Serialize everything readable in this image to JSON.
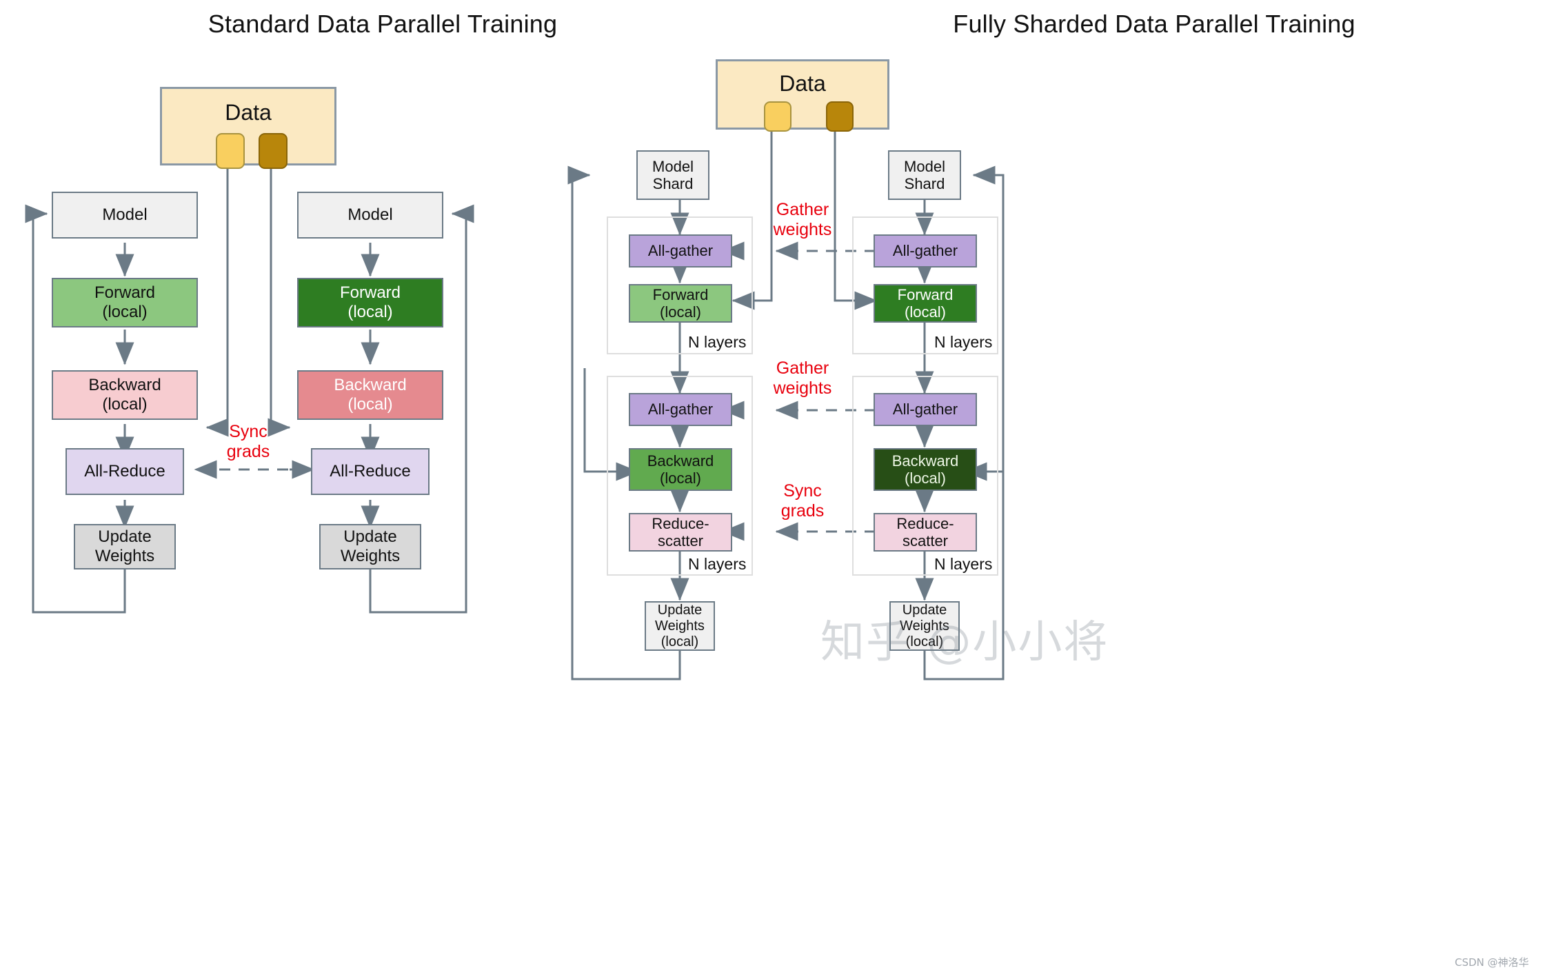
{
  "left": {
    "title": "Standard Data Parallel Training",
    "data_box": {
      "label": "Data",
      "chips": [
        "shard-light",
        "shard-dark"
      ]
    },
    "workers": [
      {
        "id": "worker-0",
        "shade": "light",
        "nodes": [
          {
            "name": "model",
            "line1": "Model",
            "line2": ""
          },
          {
            "name": "forward",
            "line1": "Forward",
            "line2": "(local)"
          },
          {
            "name": "backward",
            "line1": "Backward",
            "line2": "(local)"
          },
          {
            "name": "all-reduce",
            "line1": "All-Reduce",
            "line2": ""
          },
          {
            "name": "update-weights",
            "line1": "Update",
            "line2": "Weights"
          }
        ]
      },
      {
        "id": "worker-1",
        "shade": "dark",
        "nodes": [
          {
            "name": "model",
            "line1": "Model",
            "line2": ""
          },
          {
            "name": "forward",
            "line1": "Forward",
            "line2": "(local)"
          },
          {
            "name": "backward",
            "line1": "Backward",
            "line2": "(local)"
          },
          {
            "name": "all-reduce",
            "line1": "All-Reduce",
            "line2": ""
          },
          {
            "name": "update-weights",
            "line1": "Update",
            "line2": "Weights"
          }
        ]
      }
    ],
    "annotations": [
      {
        "name": "sync-grads",
        "line1": "Sync",
        "line2": "grads"
      }
    ]
  },
  "right": {
    "title": "Fully Sharded Data Parallel Training",
    "data_box": {
      "label": "Data",
      "chips": [
        "shard-light",
        "shard-dark"
      ]
    },
    "workers": [
      {
        "id": "worker-0",
        "shade": "light",
        "model_shard": {
          "line1": "Model",
          "line2": "Shard"
        },
        "block1": [
          {
            "name": "all-gather",
            "line1": "All-gather",
            "line2": ""
          },
          {
            "name": "forward",
            "line1": "Forward",
            "line2": "(local)"
          }
        ],
        "block1_label": "N layers",
        "block2": [
          {
            "name": "all-gather",
            "line1": "All-gather",
            "line2": ""
          },
          {
            "name": "backward",
            "line1": "Backward",
            "line2": "(local)"
          },
          {
            "name": "reduce-scatter",
            "line1": "Reduce-",
            "line2": "scatter"
          }
        ],
        "block2_label": "N layers",
        "update": {
          "line1": "Update",
          "line2": "Weights",
          "line3": "(local)"
        }
      },
      {
        "id": "worker-1",
        "shade": "dark",
        "model_shard": {
          "line1": "Model",
          "line2": "Shard"
        },
        "block1": [
          {
            "name": "all-gather",
            "line1": "All-gather",
            "line2": ""
          },
          {
            "name": "forward",
            "line1": "Forward",
            "line2": "(local)"
          }
        ],
        "block1_label": "N layers",
        "block2": [
          {
            "name": "all-gather",
            "line1": "All-gather",
            "line2": ""
          },
          {
            "name": "backward",
            "line1": "Backward",
            "line2": "(local)"
          },
          {
            "name": "reduce-scatter",
            "line1": "Reduce-",
            "line2": "scatter"
          }
        ],
        "block2_label": "N layers",
        "update": {
          "line1": "Update",
          "line2": "Weights",
          "line3": "(local)"
        }
      }
    ],
    "annotations": [
      {
        "name": "gather-weights-1",
        "line1": "Gather",
        "line2": "weights"
      },
      {
        "name": "gather-weights-2",
        "line1": "Gather",
        "line2": "weights"
      },
      {
        "name": "sync-grads",
        "line1": "Sync",
        "line2": "grads"
      }
    ]
  },
  "watermark": {
    "zhihu": "知乎 @小小将",
    "csdn": "CSDN @神洛华"
  },
  "colors": {
    "stroke": "#6b7a86",
    "red_label": "#e8000d",
    "data_fill": "#fbe9c2",
    "chip_light": "#f9cf5f",
    "chip_dark": "#b8860b",
    "grey": "#f0f0f0",
    "grey_dark": "#d9d9d9",
    "green_light": "#8cc77f",
    "green_mid": "#61aa4f",
    "green_dark": "#2e7d22",
    "green_darkest": "#274e16",
    "red_light": "#f7ccd0",
    "red_mid": "#e58a8f",
    "purple_light": "#e0d6ef",
    "purple_mid": "#b9a3da",
    "pink": "#f2d3e0"
  }
}
